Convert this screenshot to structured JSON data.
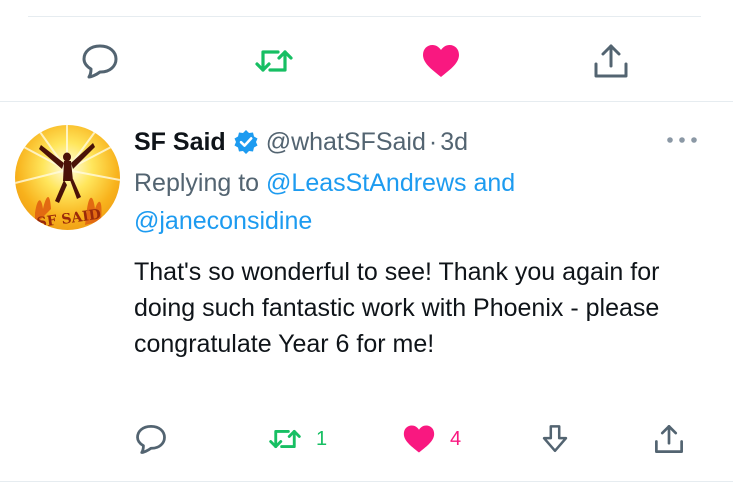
{
  "previous_tweet": {
    "actions": {
      "reply": "reply-icon",
      "retweet": "retweet-icon",
      "like": "like-icon",
      "share": "share-icon"
    },
    "colors": {
      "retweet": "#17bf63",
      "like": "#f91880",
      "neutral": "#536471"
    }
  },
  "tweet": {
    "author_name": "SF Said",
    "verified": true,
    "handle": "@whatSFSaid",
    "separator": "·",
    "timestamp": "3d",
    "more_icon": "more-horizontal-icon",
    "replying_prefix": "Replying to ",
    "mention_1": "@LeasStAndrews",
    "mention_joiner": " and",
    "mention_2": "@janeconsidine",
    "avatar_text": "SF SAID",
    "text": "That's so wonderful to see! Thank you again for doing such fantastic work with Phoenix - please congratulate Year 6 for me!",
    "retweet_count": "1",
    "like_count": "4",
    "colors": {
      "mention": "#1d9bf0",
      "verified": "#1d9bf0",
      "retweet": "#17bf63",
      "like": "#f91880",
      "secondary": "#536471"
    }
  }
}
